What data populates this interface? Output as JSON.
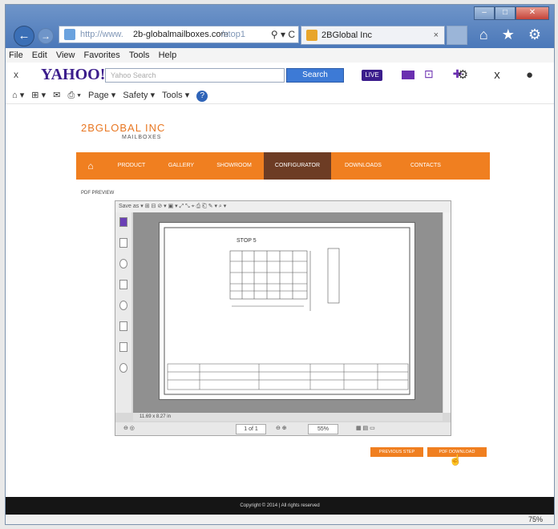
{
  "browser": {
    "window_buttons": {
      "minimize": "–",
      "maximize": "□",
      "close": "✕"
    },
    "nav": {
      "back": "←",
      "forward": "→"
    },
    "address": {
      "prefix": "http://www.",
      "domain": "2b-globalmailboxes.com",
      "suffix": "/stop1",
      "controls": "⚲ ▾ C"
    },
    "tab": {
      "label": "2BGlobal Inc",
      "close": "×"
    },
    "toolbar_icons": "⌂ ★ ⚙",
    "menu": [
      "File",
      "Edit",
      "View",
      "Favorites",
      "Tools",
      "Help"
    ],
    "yahoo": {
      "close": "x",
      "logo": "YAHOO!",
      "search_placeholder": "Yahoo Search",
      "search_button": "Search",
      "live": "LIVE",
      "right_icons": "⚙ x ●"
    },
    "commandbar": {
      "page": "Page ▾",
      "safety": "Safety ▾",
      "tools": "Tools ▾",
      "help": "?"
    }
  },
  "site": {
    "logo_main": "2BGLOBAL INC",
    "logo_sub": "MAILBOXES",
    "nav": [
      "PRODUCT",
      "GALLERY",
      "SHOWROOM",
      "CONFIGURATOR",
      "DOWNLOADS",
      "CONTACTS"
    ],
    "nav_active": "CONFIGURATOR",
    "pdf_label": "PDF PREVIEW",
    "buttons": {
      "previous": "PREVIOUS STEP",
      "download": "PDF DOWNLOAD"
    },
    "footer": "Copyright © 2014 | All rights reserved",
    "colors": {
      "accent": "#f07f20",
      "active_nav": "#6d3c24"
    }
  },
  "pdf_viewer": {
    "toolbar": "Save as ▾  ⊞ ⊟ ⊘ ▾  ▣ ▾  ⤢ ⤡ ⌖  ⎙ ⎗ ✎ ▾  ⌕ ▾",
    "page_title": "STOP 5",
    "size": "11.69 x 8.27 in",
    "page_indicator": "1 of 1",
    "zoom": "55%"
  },
  "status": {
    "zoom": "75%"
  }
}
